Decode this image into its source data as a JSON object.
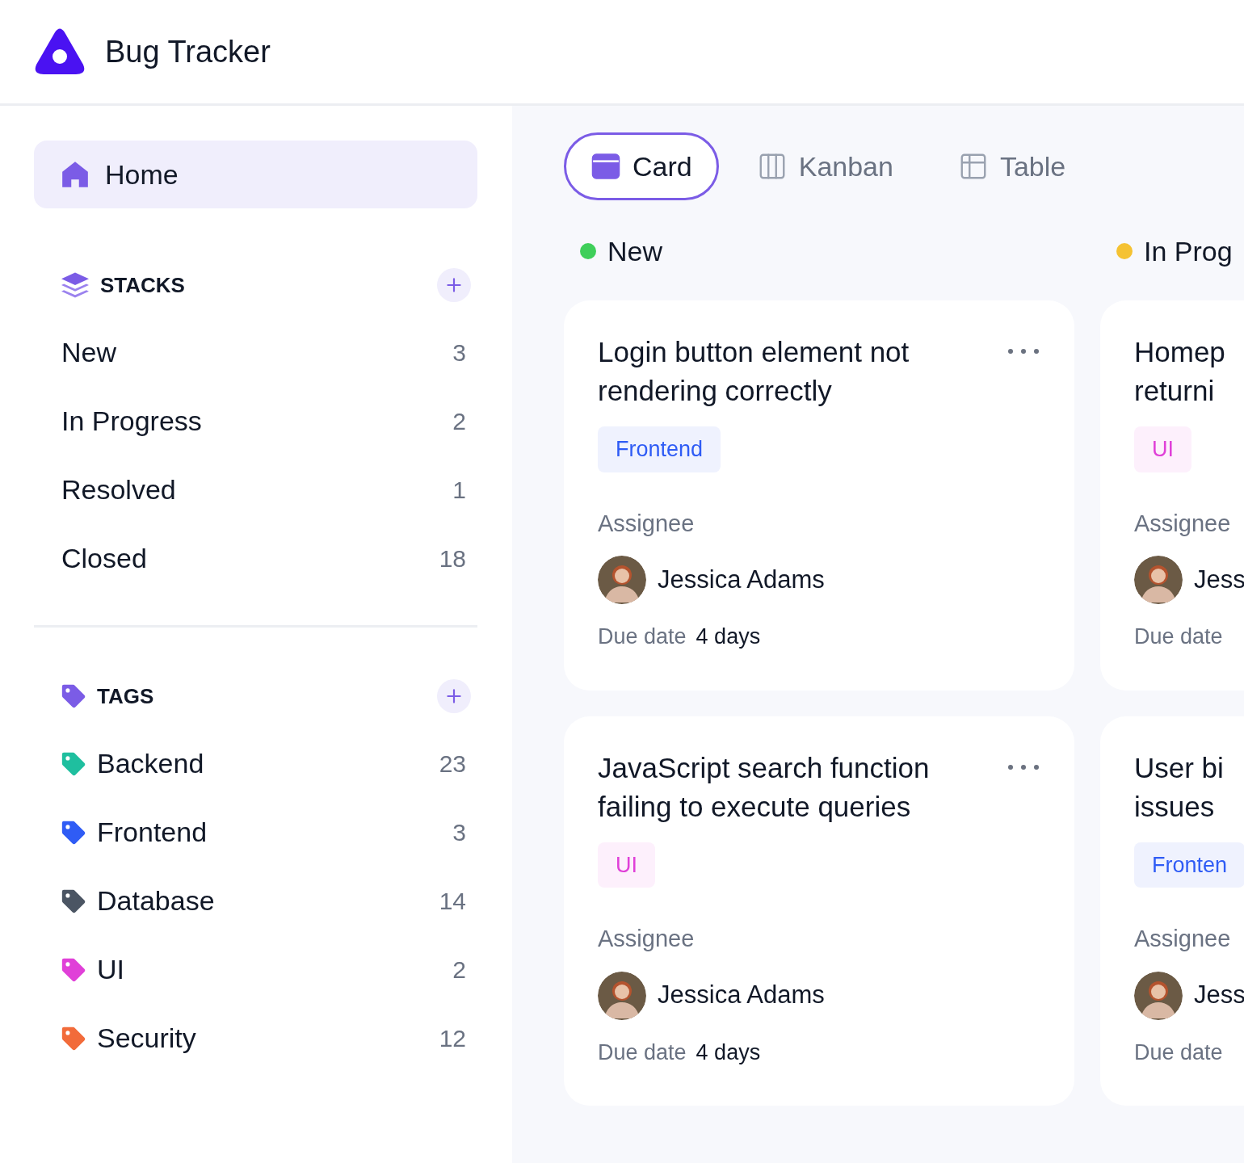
{
  "app": {
    "title": "Bug Tracker"
  },
  "sidebar": {
    "home": {
      "label": "Home",
      "selected": true
    },
    "stacks": {
      "heading": "STACKS",
      "items": [
        {
          "label": "New",
          "count": "3"
        },
        {
          "label": "In Progress",
          "count": "2"
        },
        {
          "label": "Resolved",
          "count": "1"
        },
        {
          "label": "Closed",
          "count": "18"
        }
      ]
    },
    "tags": {
      "heading": "TAGS",
      "items": [
        {
          "label": "Backend",
          "count": "23",
          "color": "#1fbf9f"
        },
        {
          "label": "Frontend",
          "count": "3",
          "color": "#2f5cf5"
        },
        {
          "label": "Database",
          "count": "14",
          "color": "#4b5563"
        },
        {
          "label": "UI",
          "count": "2",
          "color": "#e040d8"
        },
        {
          "label": "Security",
          "count": "12",
          "color": "#f26b3a"
        }
      ]
    }
  },
  "views": [
    {
      "label": "Card",
      "kind": "card",
      "selected": true
    },
    {
      "label": "Kanban",
      "kind": "kanban",
      "selected": false
    },
    {
      "label": "Table",
      "kind": "table",
      "selected": false
    }
  ],
  "columns": [
    {
      "title": "New",
      "color": "#3fcf5a",
      "cards": [
        {
          "title_lines": [
            "Login button element not",
            "rendering correctly"
          ],
          "tag": {
            "label": "Frontend",
            "color": "#2f5cf5"
          },
          "assignee_label": "Assignee",
          "assignee": "Jessica Adams",
          "due_label": "Due date",
          "due": "4 days",
          "menu": true
        },
        {
          "title_lines": [
            "JavaScript search function",
            "failing to execute queries"
          ],
          "tag": {
            "label": "UI",
            "color": "#e040d8"
          },
          "assignee_label": "Assignee",
          "assignee": "Jessica Adams",
          "due_label": "Due date",
          "due": "4 days",
          "menu": true
        }
      ]
    },
    {
      "title": "In Prog",
      "color": "#f5c232",
      "cards": [
        {
          "title_lines": [
            "Homep",
            "returni"
          ],
          "tag": {
            "label": "UI",
            "color": "#e040d8"
          },
          "assignee_label": "Assignee",
          "assignee": "Jess",
          "due_label": "Due date"
        },
        {
          "title_lines": [
            "User bi",
            "issues"
          ],
          "tag": {
            "label": "Fronten",
            "color": "#2f5cf5"
          },
          "assignee_label": "Assignee",
          "assignee": "Jess",
          "due_label": "Due date"
        }
      ]
    }
  ]
}
